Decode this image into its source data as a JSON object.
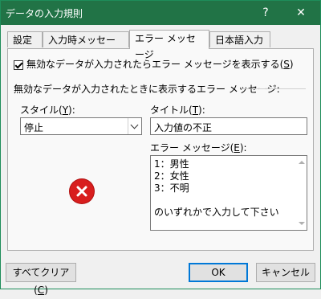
{
  "window": {
    "title": "データの入力規則",
    "help_label": "?",
    "close_label": "✕"
  },
  "tabs": [
    {
      "label": "設定"
    },
    {
      "label": "入力時メッセージ"
    },
    {
      "label": "エラー メッセージ"
    },
    {
      "label": "日本語入力"
    }
  ],
  "show_error": {
    "checked": true,
    "label": "無効なデータが入力されたらエラー メッセージを表示する(",
    "mnemonic": "S",
    "suffix": ")"
  },
  "section_label": "無効なデータが入力されたときに表示するエラー メッセージ:",
  "style": {
    "label": "スタイル(",
    "mnemonic": "Y",
    "suffix": "):",
    "value": "停止"
  },
  "title_field": {
    "label": "タイトル(",
    "mnemonic": "T",
    "suffix": "):",
    "value": "入力値の不正"
  },
  "message_field": {
    "label": "エラー メッセージ(",
    "mnemonic": "E",
    "suffix": "):",
    "value": "1：男性\n2：女性\n3：不明\n\nのいずれかで入力して下さい"
  },
  "icon": {
    "name": "error-stop-icon",
    "color": "#d81e1e"
  },
  "buttons": {
    "clear_all": {
      "label": "すべてクリア(",
      "mnemonic": "C",
      "suffix": ")"
    },
    "ok": "OK",
    "cancel": "キャンセル"
  },
  "colors": {
    "titlebar": "#217346",
    "accent": "#0078d7"
  }
}
